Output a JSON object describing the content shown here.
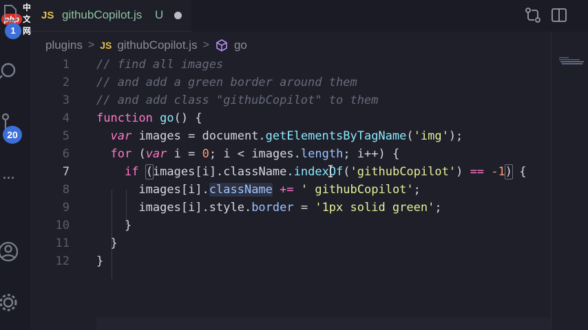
{
  "watermark": {
    "logo_text": "php",
    "site_text": "中文网"
  },
  "activity_bar": {
    "icons": [
      "files-icon",
      "search-icon",
      "source-control-icon",
      "more-icon",
      "account-icon",
      "settings-gear-icon"
    ],
    "explorer_badge": "1",
    "source_control_badge": "20",
    "more_label": "..."
  },
  "tab": {
    "language_badge": "JS",
    "file_name": "githubCopilot.js",
    "git_status": "U",
    "unsaved_indicator": "dot"
  },
  "title_actions": [
    "compare-changes-icon",
    "split-editor-icon"
  ],
  "breadcrumb": {
    "folder": "plugins",
    "language_badge": "JS",
    "file": "githubCopilot.js",
    "symbol": "go",
    "separator": ">"
  },
  "editor": {
    "active_line": 7,
    "lines": [
      {
        "number": "1",
        "text": "// find all images"
      },
      {
        "number": "2",
        "text": "// and add a green border around them"
      },
      {
        "number": "3",
        "text": "// and add class \"githubCopilot\" to them"
      },
      {
        "number": "4",
        "text": "function go() {"
      },
      {
        "number": "5",
        "text": "  var images = document.getElementsByTagName('img');"
      },
      {
        "number": "6",
        "text": "  for (var i = 0; i < images.length; i++) {"
      },
      {
        "number": "7",
        "text": "    if (images[i].className.indexOf('githubCopilot') == -1) {"
      },
      {
        "number": "8",
        "text": "      images[i].className += ' githubCopilot';"
      },
      {
        "number": "9",
        "text": "      images[i].style.border = '1px solid green';"
      },
      {
        "number": "10",
        "text": "    }"
      },
      {
        "number": "11",
        "text": "  }"
      },
      {
        "number": "12",
        "text": "}"
      }
    ],
    "tokens": {
      "l1": "// find all images",
      "l2": "// and add a green border around them",
      "l3": "// and add class \"githubCopilot\" to them",
      "l4_kw": "function",
      "l4_fn": "go",
      "l4_rest": "() {",
      "l5_kw": "var",
      "l5_a": " images = document.",
      "l5_fn": "getElementsByTagName",
      "l5_b": "(",
      "l5_str": "'img'",
      "l5_c": ");",
      "l6_kw": "for",
      "l6_a": " (",
      "l6_kw2": "var",
      "l6_b": " i = ",
      "l6_num": "0",
      "l6_c": "; i < images.",
      "l6_prop": "length",
      "l6_d": "; i++) {",
      "l7_kw": "if",
      "l7_a": " ",
      "l7_br1": "(",
      "l7_b": "images[i].className.",
      "l7_fn": "indexOf",
      "l7_c": "(",
      "l7_str": "'githubCopilot'",
      "l7_d": ") ",
      "l7_op": "==",
      "l7_e": " ",
      "l7_num": "-1",
      "l7_br2": ")",
      "l7_f": " {",
      "l8_a": "images[i].",
      "l8_prop": "className",
      "l8_b": " ",
      "l8_op": "+=",
      "l8_c": " ",
      "l8_str": "' githubCopilot'",
      "l8_d": ";",
      "l9_a": "images[i].style.",
      "l9_prop": "border",
      "l9_b": " = ",
      "l9_str": "'1px solid green'",
      "l9_c": ";",
      "l10": "}",
      "l11": "}",
      "l12": "}"
    }
  },
  "colors": {
    "background": "#1e1f29",
    "keyword": "#ff79c6",
    "function": "#8be9fd",
    "string": "#e7ee98",
    "comment": "#676a7a",
    "badge": "#3d6fd8",
    "js_badge": "#e4c34a",
    "untracked_file": "#8fc3a0"
  }
}
